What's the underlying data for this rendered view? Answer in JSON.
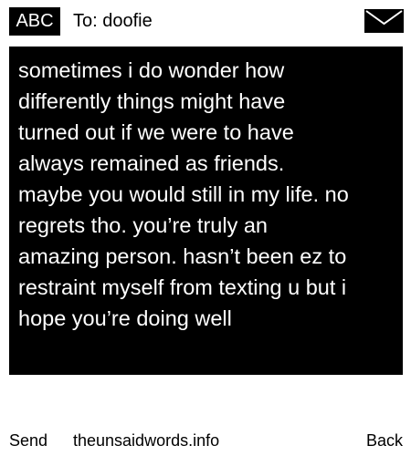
{
  "header": {
    "mode_label": "ABC",
    "recipient": "To: doofie",
    "envelope_icon": "envelope-icon"
  },
  "message": {
    "text": "sometimes i do wonder how\ndifferently things might have\nturned out if we were to have\nalways remained as friends.\nmaybe you would still in my life. no\nregrets tho. you’re truly an\namazing person. hasn’t been ez to\nrestraint myself from texting u but i\nhope you’re doing well"
  },
  "footer": {
    "send_label": "Send",
    "site_label": "theunsaidwords.info",
    "back_label": "Back"
  },
  "colors": {
    "background": "#ffffff",
    "message_background": "#000000",
    "message_text": "#ffffff"
  }
}
